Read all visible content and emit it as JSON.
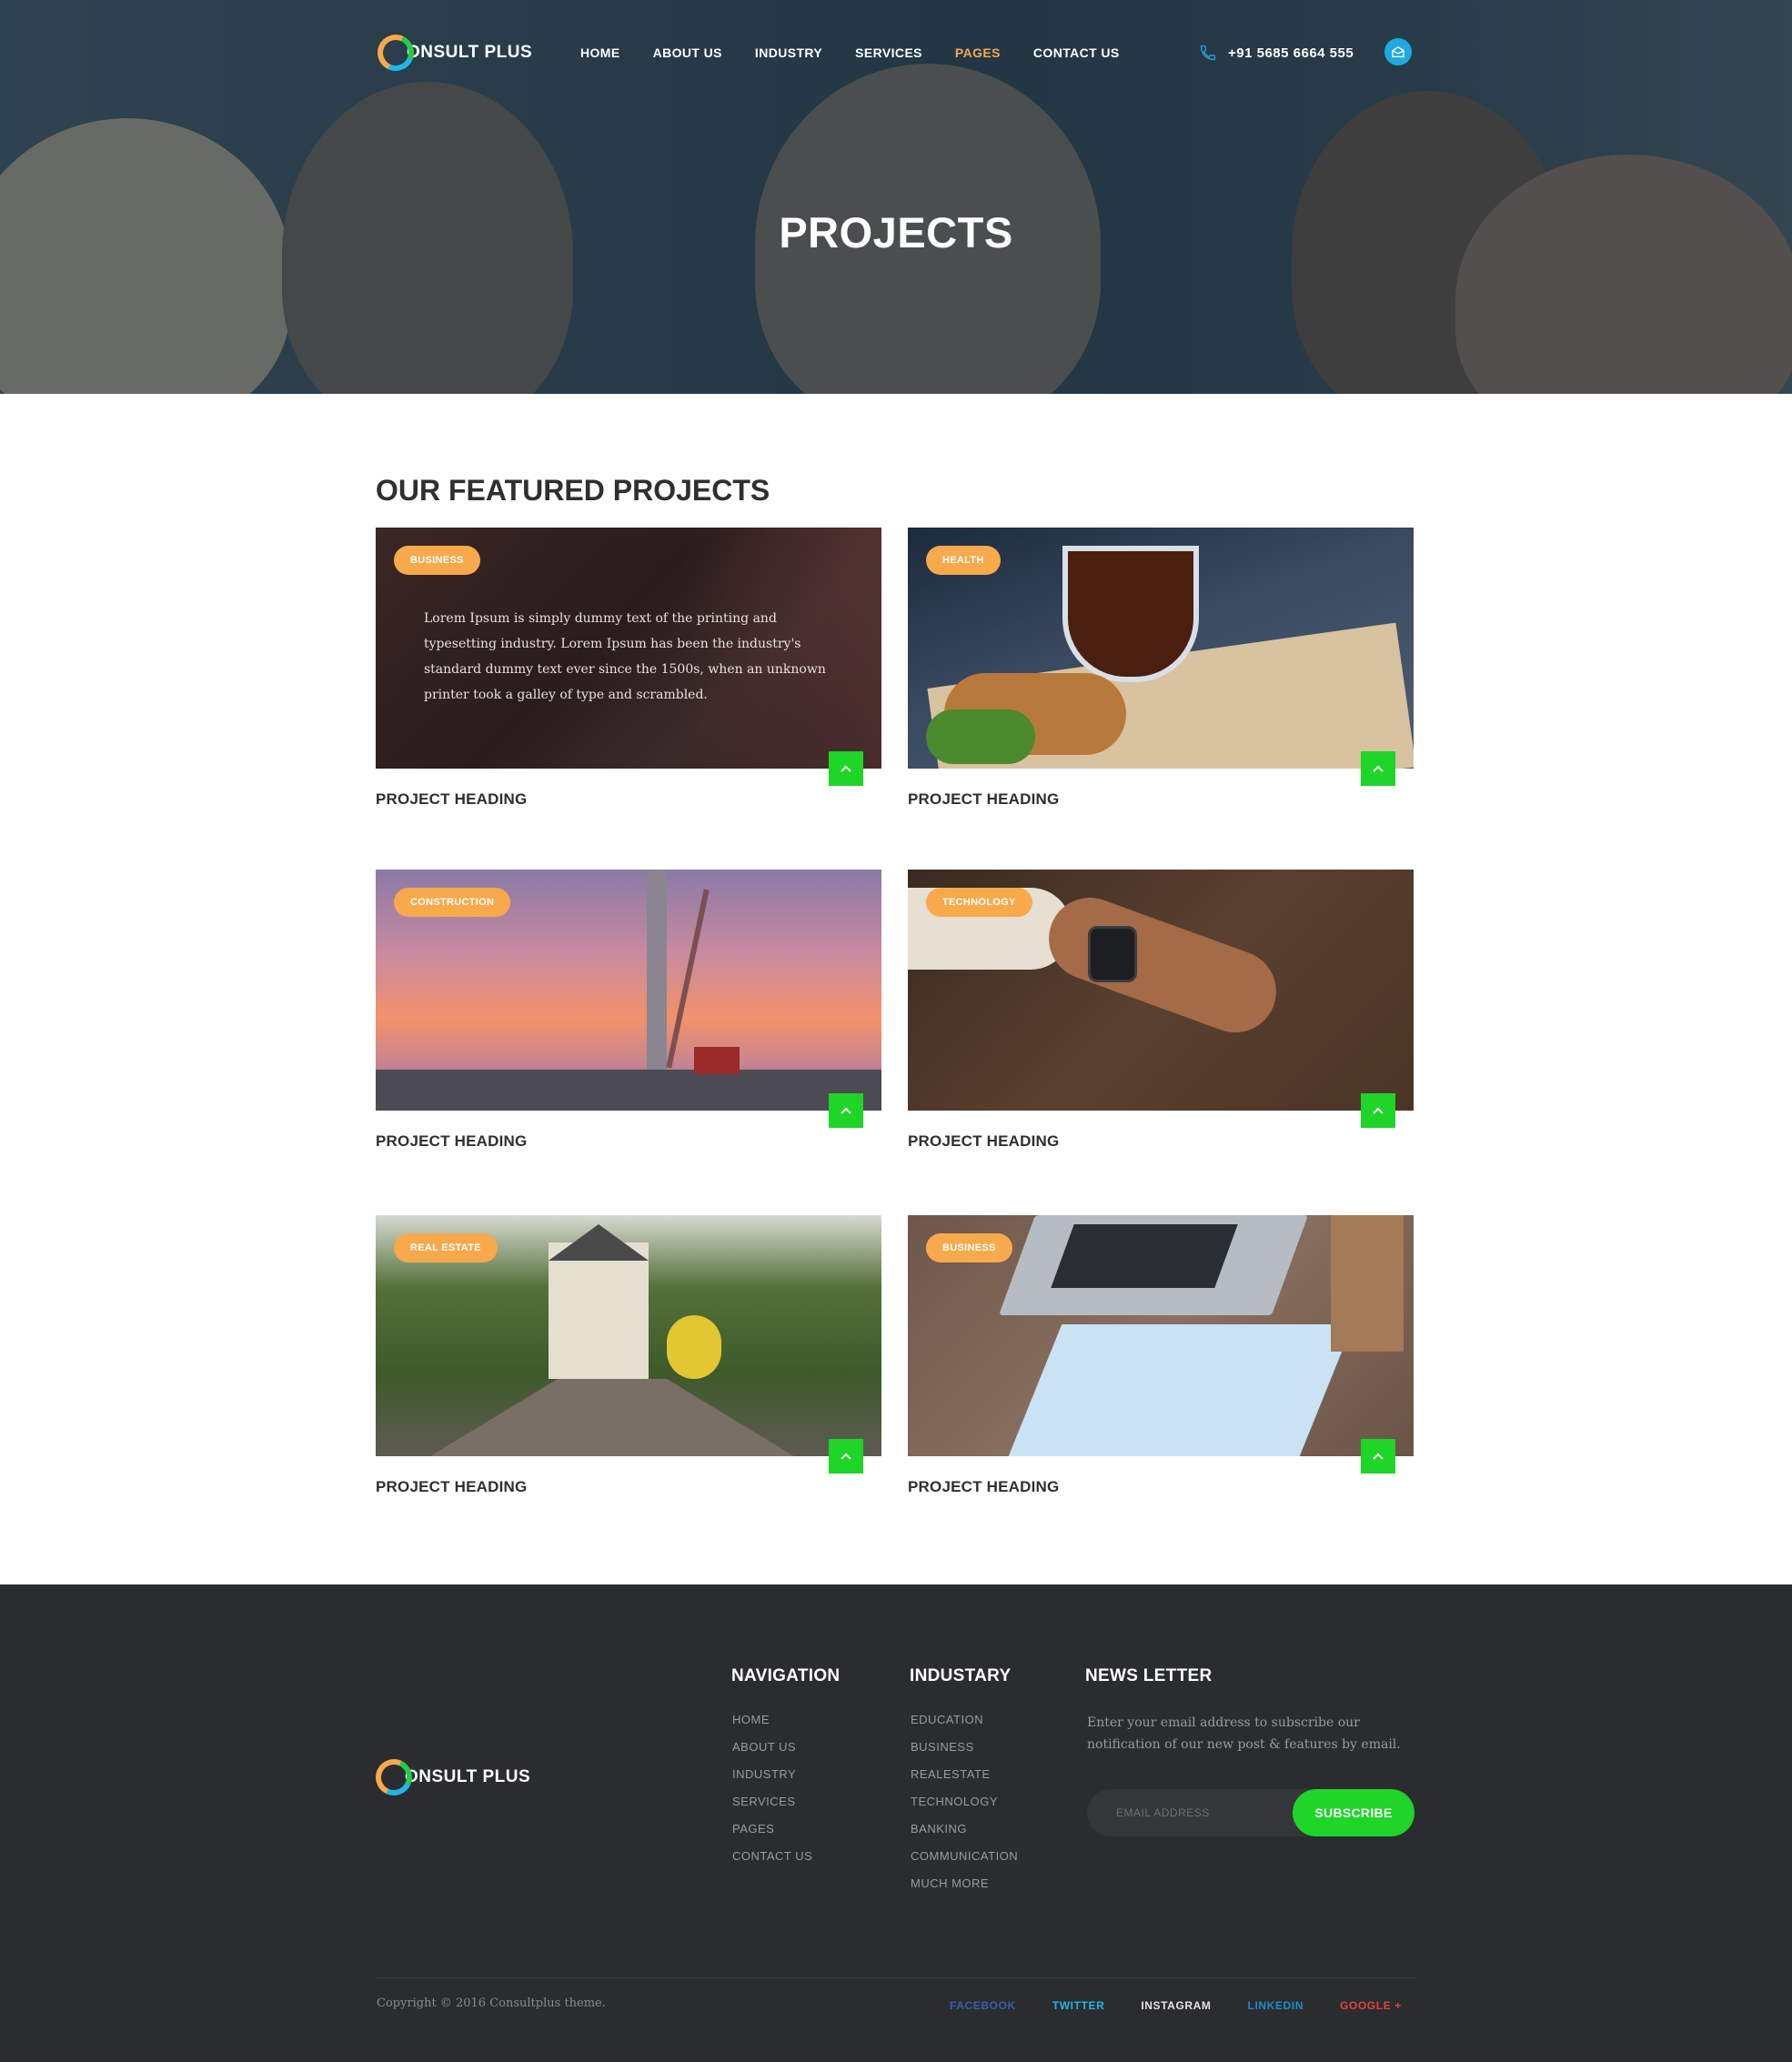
{
  "brand": {
    "logo_text": "ONSULT PLUS"
  },
  "nav": {
    "items": [
      {
        "label": "HOME"
      },
      {
        "label": "ABOUT US"
      },
      {
        "label": "INDUSTRY"
      },
      {
        "label": "SERVICES"
      },
      {
        "label": "PAGES",
        "active": true
      },
      {
        "label": "CONTACT US"
      }
    ],
    "phone": "+91 5685 6664 555",
    "phone_icon": "phone-icon",
    "mail_icon": "envelope-icon"
  },
  "hero": {
    "title": "PROJECTS"
  },
  "projects": {
    "section_title": "OUR FEATURED PROJECTS",
    "cards": [
      {
        "tag": "BUSINESS",
        "heading": "PROJECT HEADING",
        "description": "Lorem Ipsum is simply dummy text of the printing and typesetting industry. Lorem Ipsum has been the industry's standard dummy text ever since the 1500s, when an unknown printer took a galley of type and scrambled."
      },
      {
        "tag": "HEALTH",
        "heading": "PROJECT HEADING"
      },
      {
        "tag": "CONSTRUCTION",
        "heading": "PROJECT HEADING"
      },
      {
        "tag": "TECHNOLOGY",
        "heading": "PROJECT HEADING"
      },
      {
        "tag": "REAL ESTATE",
        "heading": "PROJECT HEADING"
      },
      {
        "tag": "BUSINESS",
        "heading": "PROJECT HEADING"
      }
    ]
  },
  "footer": {
    "logo_text": "ONSULT PLUS",
    "navigation": {
      "title": "NAVIGATION",
      "items": [
        "HOME",
        "ABOUT US",
        "INDUSTRY",
        "SERVICES",
        "PAGES",
        "CONTACT US"
      ]
    },
    "industary": {
      "title": "INDUSTARY",
      "items": [
        "EDUCATION",
        "BUSINESS",
        "REALESTATE",
        "TECHNOLOGY",
        "BANKING",
        "COMMUNICATION",
        "MUCH MORE"
      ]
    },
    "newsletter": {
      "title": "NEWS LETTER",
      "text": "Enter your email address to subscribe our notification of our new post & features by email.",
      "placeholder": "EMAIL ADDRESS",
      "button": "SUBSCRIBE"
    },
    "copyright": "Copyright © 2016 Consultplus theme.",
    "social": [
      {
        "label": "FACEBOOK",
        "color": "#3b5fa8"
      },
      {
        "label": "TWITTER",
        "color": "#1fb7e8"
      },
      {
        "label": "INSTAGRAM",
        "color": "#e4e4e4"
      },
      {
        "label": "LINKEDIN",
        "color": "#1a8fc9"
      },
      {
        "label": "GOOGLE +",
        "color": "#e2463a"
      }
    ]
  },
  "colors": {
    "accent_orange": "#f7a94c",
    "accent_green": "#1ed528",
    "accent_blue": "#1fa9e0",
    "footer_bg": "#2b2c2f"
  }
}
